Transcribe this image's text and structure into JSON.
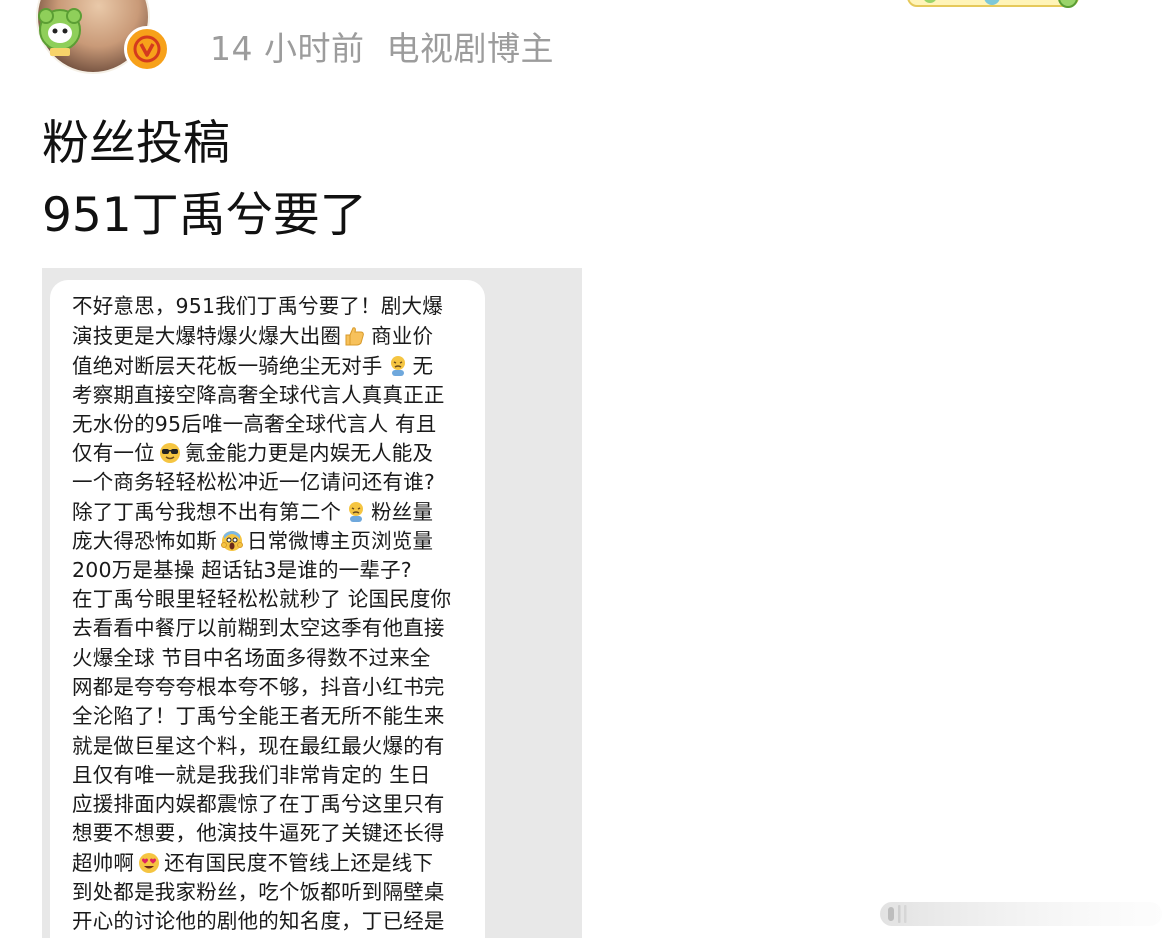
{
  "header": {
    "time": "14 小时前",
    "role": "电视剧博主",
    "avatar_icon": "user-avatar",
    "verified_icon": "verified-v-badge",
    "verified_letter": "v",
    "accent_color": "#f7a11a"
  },
  "post": {
    "title_line1": "粉丝投稿",
    "title_line2": "951丁禹兮要了"
  },
  "message": {
    "lines": [
      "不好意思，951我们丁禹兮要了！剧大爆",
      "演技更是大爆特爆火爆大出圈",
      "商业价",
      "值绝对断层天花板一骑绝尘无对手",
      "无",
      "考察期直接空降高奢全球代言人真真正正",
      "无水份的95后唯一高奢全球代言人  有且",
      "仅有一位",
      "氪金能力更是内娱无人能及",
      "一个商务轻轻松松冲近一亿请问还有谁?",
      "除了丁禹兮我想不出有第二个",
      "粉丝量",
      "庞大得恐怖如斯",
      "日常微博主页浏览量",
      "200万是基操  超话钻3是谁的一辈子?",
      "在丁禹兮眼里轻轻松松就秒了 论国民度你",
      "去看看中餐厅以前糊到太空这季有他直接",
      "火爆全球  节目中名场面多得数不过来全",
      "网都是夸夸夸根本夸不够，抖音小红书完",
      "全沦陷了！丁禹兮全能王者无所不能生来",
      "就是做巨星这个料，现在最红最火爆的有",
      "且仅有唯一就是我我们非常肯定的  生日",
      "应援排面内娱都震惊了在丁禹兮这里只有",
      "想要不想要，他演技牛逼死了关键还长得",
      "超帅啊",
      "还有国民度不管线上还是线下",
      "到处都是我家粉丝，吃个饭都听到隔壁桌",
      "开心的讨论他的剧他的知名度，丁已经是"
    ],
    "emoji_icons": [
      "thumbs-up-emoji",
      "tired-face-emoji",
      "sunglasses-emoji",
      "tired-face-emoji",
      "screaming-face-emoji",
      "heart-eyes-emoji"
    ]
  },
  "ui": {
    "scroll_icon": "horizontal-scroll-handle-icon",
    "deco_icon": "decoration-sticker-icon"
  }
}
